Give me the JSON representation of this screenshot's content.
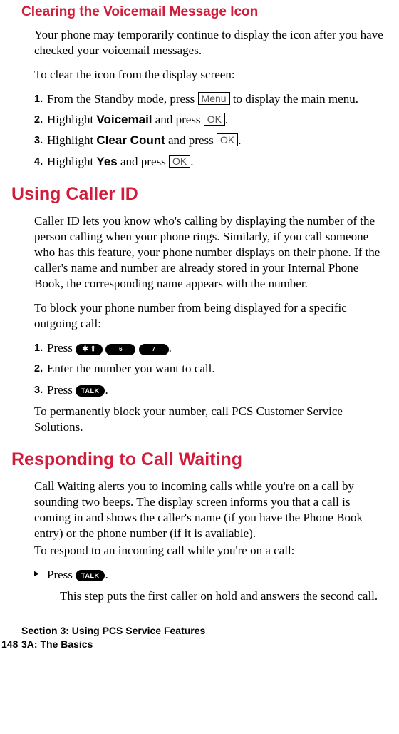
{
  "sec1": {
    "title": "Clearing the Voicemail Message Icon",
    "p1": "Your phone may temporarily continue to display the icon after you have checked your voicemail messages.",
    "p2": "To clear the icon from the display screen:",
    "s1a": "From the Standby mode, press ",
    "s1key": "Menu",
    "s1b": " to display the main menu.",
    "s2a": "Highlight ",
    "s2bold": "Voicemail",
    "s2b": " and press ",
    "s3a": "Highlight ",
    "s3bold": "Clear Count",
    "s3b": " and press ",
    "s4a": "Highlight ",
    "s4bold": "Yes",
    "s4b": " and press ",
    "ok": "OK",
    "dot": "."
  },
  "sec2": {
    "title": "Using Caller ID",
    "p1": "Caller ID lets you know who's calling by displaying the number of the person calling when your phone rings. Similarly, if you call someone who has this feature, your phone number displays on their phone. If the caller's name and number are already stored in your Internal Phone Book, the corresponding name appears with the number.",
    "p2": "To block your phone number from being displayed for a specific outgoing call:",
    "s1a": "Press ",
    "s2": "Enter the number you want to call.",
    "s3a": "Press ",
    "p3": "To permanently block your number, call PCS Customer Service Solutions.",
    "keys": {
      "star": "✱ ⇧",
      "k6": "6",
      "k7": "7",
      "talk": "TALK"
    }
  },
  "sec3": {
    "title": "Responding to Call Waiting",
    "p1": "Call Waiting alerts you to incoming calls while you're on a call by sounding two beeps. The display screen informs you that a call is coming in and shows the caller's name (if you have the Phone Book entry) or the phone number (if it is available).",
    "p2": "To respond to an incoming call while you're on a call:",
    "b1a": "Press ",
    "talk": "TALK",
    "result": "This step puts the first caller on hold and answers the second call."
  },
  "nums": {
    "n1": "1.",
    "n2": "2.",
    "n3": "3.",
    "n4": "4."
  },
  "marker": "▸",
  "footer": {
    "l1": "Section 3: Using PCS Service Features",
    "page": "148",
    "l2": "3A: The Basics"
  }
}
